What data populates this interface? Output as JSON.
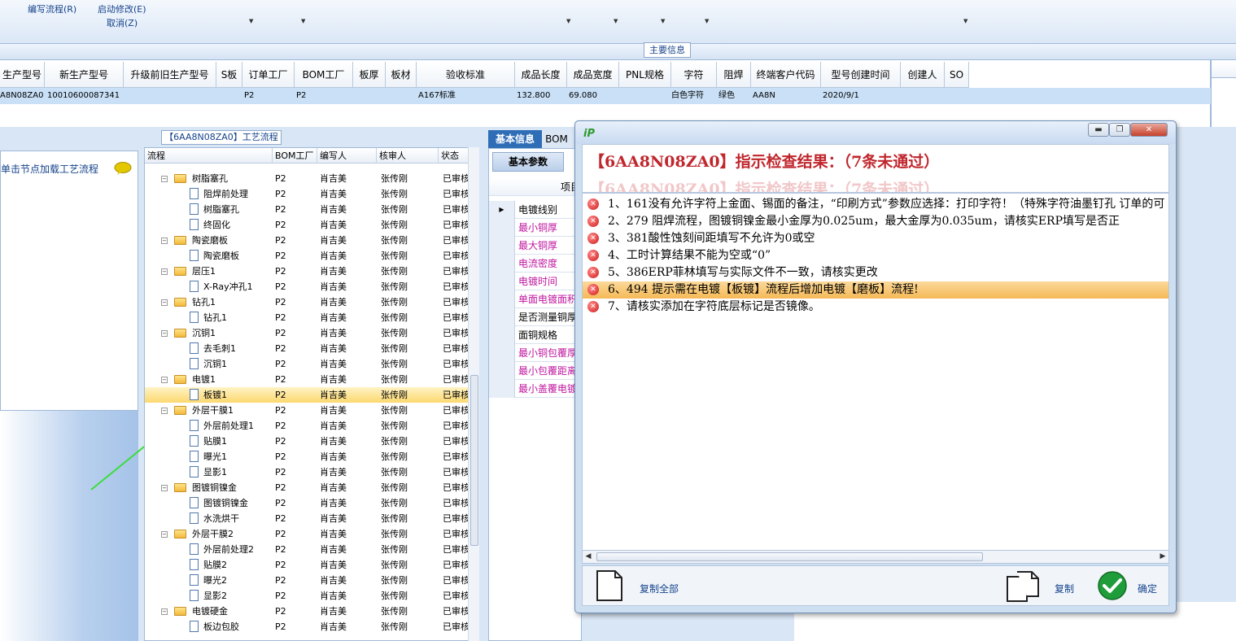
{
  "ribbon": {
    "items": [
      {
        "label": "编写流程(R)"
      },
      {
        "label": "启动修改(E)"
      },
      {
        "label": "取消(Z)"
      }
    ]
  },
  "main_info": {
    "title": "主要信息",
    "columns": [
      "生产型号",
      "新生产型号",
      "升级前旧生产型号",
      "S板",
      "订单工厂",
      "BOM工厂",
      "板厚",
      "板材",
      "验收标准",
      "成品长度",
      "成品宽度",
      "PNL规格",
      "字符",
      "阻焊",
      "终端客户代码",
      "型号创建时间",
      "创建人",
      "SO"
    ],
    "row": {
      "model": "A8N08ZA0",
      "new_model": "10010600087341",
      "order_factory": "P2",
      "bom_factory": "P2",
      "standard": "A167标准",
      "length": "132.800",
      "width": "69.080",
      "char": "白色字符",
      "mask": "绿色",
      "customer": "AA8N",
      "created": "2020/9/1"
    }
  },
  "left_panel": {
    "hint": "单击节点加载工艺流程"
  },
  "process_panel": {
    "title": "【6AA8N08ZA0】工艺流程",
    "columns": [
      "流程",
      "BOM工厂",
      "编写人",
      "核审人",
      "状态"
    ],
    "rows": [
      {
        "name": "树脂塞孔",
        "level": 1,
        "folder": true,
        "factory": "P2",
        "writer": "肖吉美",
        "reviewer": "张传刚",
        "status": "已审核"
      },
      {
        "name": "阻焊前处理",
        "level": 2,
        "folder": false,
        "factory": "P2",
        "writer": "肖吉美",
        "reviewer": "张传刚",
        "status": "已审核"
      },
      {
        "name": "树脂塞孔",
        "level": 2,
        "folder": false,
        "factory": "P2",
        "writer": "肖吉美",
        "reviewer": "张传刚",
        "status": "已审核"
      },
      {
        "name": "终固化",
        "level": 2,
        "folder": false,
        "factory": "P2",
        "writer": "肖吉美",
        "reviewer": "张传刚",
        "status": "已审核"
      },
      {
        "name": "陶瓷磨板",
        "level": 1,
        "folder": true,
        "factory": "P2",
        "writer": "肖吉美",
        "reviewer": "张传刚",
        "status": "已审核"
      },
      {
        "name": "陶瓷磨板",
        "level": 2,
        "folder": false,
        "factory": "P2",
        "writer": "肖吉美",
        "reviewer": "张传刚",
        "status": "已审核"
      },
      {
        "name": "层压1",
        "level": 1,
        "folder": true,
        "factory": "P2",
        "writer": "肖吉美",
        "reviewer": "张传刚",
        "status": "已审核"
      },
      {
        "name": "X-Ray冲孔1",
        "level": 2,
        "folder": false,
        "factory": "P2",
        "writer": "肖吉美",
        "reviewer": "张传刚",
        "status": "已审核"
      },
      {
        "name": "钻孔1",
        "level": 1,
        "folder": true,
        "factory": "P2",
        "writer": "肖吉美",
        "reviewer": "张传刚",
        "status": "已审核"
      },
      {
        "name": "钻孔1",
        "level": 2,
        "folder": false,
        "factory": "P2",
        "writer": "肖吉美",
        "reviewer": "张传刚",
        "status": "已审核"
      },
      {
        "name": "沉铜1",
        "level": 1,
        "folder": true,
        "factory": "P2",
        "writer": "肖吉美",
        "reviewer": "张传刚",
        "status": "已审核"
      },
      {
        "name": "去毛刺1",
        "level": 2,
        "folder": false,
        "factory": "P2",
        "writer": "肖吉美",
        "reviewer": "张传刚",
        "status": "已审核"
      },
      {
        "name": "沉铜1",
        "level": 2,
        "folder": false,
        "factory": "P2",
        "writer": "肖吉美",
        "reviewer": "张传刚",
        "status": "已审核"
      },
      {
        "name": "电镀1",
        "level": 1,
        "folder": true,
        "factory": "P2",
        "writer": "肖吉美",
        "reviewer": "张传刚",
        "status": "已审核"
      },
      {
        "name": "板镀1",
        "level": 2,
        "folder": false,
        "selected": true,
        "factory": "P2",
        "writer": "肖吉美",
        "reviewer": "张传刚",
        "status": "已审核"
      },
      {
        "name": "外层干膜1",
        "level": 1,
        "folder": true,
        "factory": "P2",
        "writer": "肖吉美",
        "reviewer": "张传刚",
        "status": "已审核"
      },
      {
        "name": "外层前处理1",
        "level": 2,
        "folder": false,
        "factory": "P2",
        "writer": "肖吉美",
        "reviewer": "张传刚",
        "status": "已审核"
      },
      {
        "name": "贴膜1",
        "level": 2,
        "folder": false,
        "factory": "P2",
        "writer": "肖吉美",
        "reviewer": "张传刚",
        "status": "已审核"
      },
      {
        "name": "曝光1",
        "level": 2,
        "folder": false,
        "factory": "P2",
        "writer": "肖吉美",
        "reviewer": "张传刚",
        "status": "已审核"
      },
      {
        "name": "显影1",
        "level": 2,
        "folder": false,
        "factory": "P2",
        "writer": "肖吉美",
        "reviewer": "张传刚",
        "status": "已审核"
      },
      {
        "name": "图镀铜镍金",
        "level": 1,
        "folder": true,
        "factory": "P2",
        "writer": "肖吉美",
        "reviewer": "张传刚",
        "status": "已审核"
      },
      {
        "name": "图镀铜镍金",
        "level": 2,
        "folder": false,
        "factory": "P2",
        "writer": "肖吉美",
        "reviewer": "张传刚",
        "status": "已审核"
      },
      {
        "name": "水洗烘干",
        "level": 2,
        "folder": false,
        "factory": "P2",
        "writer": "肖吉美",
        "reviewer": "张传刚",
        "status": "已审核"
      },
      {
        "name": "外层干膜2",
        "level": 1,
        "folder": true,
        "factory": "P2",
        "writer": "肖吉美",
        "reviewer": "张传刚",
        "status": "已审核"
      },
      {
        "name": "外层前处理2",
        "level": 2,
        "folder": false,
        "factory": "P2",
        "writer": "肖吉美",
        "reviewer": "张传刚",
        "status": "已审核"
      },
      {
        "name": "贴膜2",
        "level": 2,
        "folder": false,
        "factory": "P2",
        "writer": "肖吉美",
        "reviewer": "张传刚",
        "status": "已审核"
      },
      {
        "name": "曝光2",
        "level": 2,
        "folder": false,
        "factory": "P2",
        "writer": "肖吉美",
        "reviewer": "张传刚",
        "status": "已审核"
      },
      {
        "name": "显影2",
        "level": 2,
        "folder": false,
        "factory": "P2",
        "writer": "肖吉美",
        "reviewer": "张传刚",
        "status": "已审核"
      },
      {
        "name": "电镀硬金",
        "level": 1,
        "folder": true,
        "factory": "P2",
        "writer": "肖吉美",
        "reviewer": "张传刚",
        "status": "已审核"
      },
      {
        "name": "板边包胶",
        "level": 2,
        "folder": false,
        "factory": "P2",
        "writer": "肖吉美",
        "reviewer": "张传刚",
        "status": "已审核"
      }
    ]
  },
  "basic_info": {
    "tabs": [
      "基本信息",
      "BOM"
    ],
    "subtab": "基本参数",
    "col_header": "项目",
    "rows": [
      {
        "label": "电镀线别",
        "color": "#000000"
      },
      {
        "label": "最小铜厚",
        "color": "#c0169f"
      },
      {
        "label": "最大铜厚",
        "color": "#c0169f"
      },
      {
        "label": "电流密度",
        "color": "#c0169f"
      },
      {
        "label": "电镀时间",
        "color": "#c0169f"
      },
      {
        "label": "单面电镀面积",
        "color": "#c0169f"
      },
      {
        "label": "是否测量铜厚",
        "color": "#000000"
      },
      {
        "label": "面铜规格",
        "color": "#000000"
      },
      {
        "label": "最小铜包覆厚",
        "color": "#c0169f"
      },
      {
        "label": "最小包覆距离",
        "color": "#c0169f"
      },
      {
        "label": "最小盖覆电镀",
        "color": "#c0169f"
      }
    ]
  },
  "dialog": {
    "logo": "iP",
    "title": "【6AA8N08ZA0】指示检查结果：（7条未通过）",
    "items": [
      {
        "text": "1、161没有允许字符上金面、锡面的备注，“印刷方式”参数应选择：打印字符！（特殊字符油墨钉孔 订单的可"
      },
      {
        "text": "2、279 阻焊流程，图镀铜镍金最小金厚为0.025um，最大金厚为0.035um，请核实ERP填写是否正"
      },
      {
        "text": "3、381酸性蚀刻间距填写不允许为0或空"
      },
      {
        "text": "4、工时计算结果不能为空或“0”"
      },
      {
        "text": "5、386ERP菲林填写与实际文件不一致，请核实更改"
      },
      {
        "text": "6、494 提示需在电镀【板镀】流程后增加电镀【磨板】流程!",
        "selected": true
      },
      {
        "text": "7、请核实添加在字符底层标记是否镜像。"
      }
    ],
    "buttons": {
      "copy_all": "复制全部",
      "copy": "复制",
      "ok": "确定"
    }
  },
  "colors": {
    "title_red": "#c0272d",
    "selection_orange": "#f5b956",
    "grid_selection": "#c9e0f7",
    "ok_green": "#1f9d3a"
  }
}
